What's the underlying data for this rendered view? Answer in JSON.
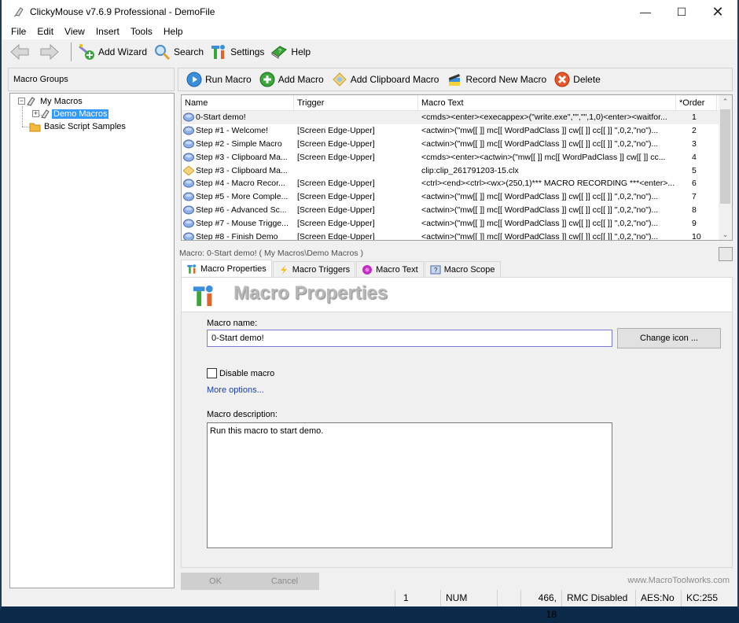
{
  "window": {
    "title": "ClickyMouse v7.6.9 Professional - DemoFile",
    "controls": [
      "minimize",
      "maximize",
      "close"
    ]
  },
  "menu": [
    "File",
    "Edit",
    "View",
    "Insert",
    "Tools",
    "Help"
  ],
  "toolbar": {
    "back_icon": "back-arrow-icon",
    "forward_icon": "forward-arrow-icon",
    "add_wizard": "Add Wizard",
    "search": "Search",
    "settings": "Settings",
    "help": "Help"
  },
  "groups": {
    "header": "Macro Groups",
    "tree": [
      {
        "label": "My Macros",
        "level": 0,
        "expanded": true
      },
      {
        "label": "Demo Macros",
        "level": 1,
        "selected": true
      },
      {
        "label": "Basic Script Samples",
        "level": 0
      }
    ]
  },
  "macro_toolbar": {
    "run": "Run Macro",
    "add": "Add Macro",
    "add_clipboard": "Add Clipboard Macro",
    "record": "Record New Macro",
    "delete": "Delete"
  },
  "macro_list": {
    "columns": [
      "Name",
      "Trigger",
      "Macro Text",
      "*Order"
    ],
    "rows": [
      {
        "name": "0-Start demo!",
        "trigger": "",
        "text": "<cmds><enter><execappex>(\"write.exe\",\"\",\"\",1,0)<enter><waitfor...",
        "order": "1",
        "icon": "macro"
      },
      {
        "name": "Step #1 - Welcome!",
        "trigger": "[Screen Edge-Upper]",
        "text": "<actwin>(\"mw[[ ]] mc[[ WordPadClass ]] cw[[ ]] cc[[ ]] \",0,2,\"no\")...",
        "order": "2",
        "icon": "macro"
      },
      {
        "name": "Step #2 - Simple Macro",
        "trigger": "[Screen Edge-Upper]",
        "text": "<actwin>(\"mw[[ ]] mc[[ WordPadClass ]] cw[[ ]] cc[[ ]] \",0,2,\"no\")...",
        "order": "3",
        "icon": "macro"
      },
      {
        "name": "Step #3 - Clipboard Ma...",
        "trigger": "[Screen Edge-Upper]",
        "text": "<cmds><enter><actwin>(\"mw[[ ]] mc[[ WordPadClass ]] cw[[ ]] cc...",
        "order": "4",
        "icon": "macro"
      },
      {
        "name": "Step #3 - Clipboard Ma...",
        "trigger": "",
        "text": "clip:clip_261791203-15.clx",
        "order": "5",
        "icon": "clipboard"
      },
      {
        "name": "Step #4 - Macro Recor...",
        "trigger": "[Screen Edge-Upper]",
        "text": "<ctrl><end><ctrl><wx>(250,1)*** MACRO RECORDING ***<enter>...",
        "order": "6",
        "icon": "macro"
      },
      {
        "name": "Step #5 - More Comple...",
        "trigger": "[Screen Edge-Upper]",
        "text": "<actwin>(\"mw[[ ]] mc[[ WordPadClass ]] cw[[ ]] cc[[ ]] \",0,2,\"no\")...",
        "order": "7",
        "icon": "macro"
      },
      {
        "name": "Step #6 - Advanced Sc...",
        "trigger": "[Screen Edge-Upper]",
        "text": "<actwin>(\"mw[[ ]] mc[[ WordPadClass ]] cw[[ ]] cc[[ ]] \",0,2,\"no\")...",
        "order": "8",
        "icon": "macro"
      },
      {
        "name": "Step #7 - Mouse Trigge...",
        "trigger": "[Screen Edge-Upper]",
        "text": "<actwin>(\"mw[[ ]] mc[[ WordPadClass ]] cw[[ ]] cc[[ ]] \",0,2,\"no\")...",
        "order": "9",
        "icon": "macro"
      },
      {
        "name": "Step #8 - Finish Demo",
        "trigger": "[Screen Edge-Upper]",
        "text": "<actwin>(\"mw[[ ]] mc[[ WordPadClass ]] cw[[ ]] cc[[ ]] \",0,2,\"no\")...",
        "order": "10",
        "icon": "macro"
      }
    ]
  },
  "detail": {
    "path": "Macro: 0-Start demo! ( My Macros\\Demo Macros )",
    "tabs": [
      "Macro Properties",
      "Macro Triggers",
      "Macro Text",
      "Macro Scope"
    ],
    "active_tab": "Macro Properties",
    "banner_title": "Macro Properties",
    "name_label": "Macro name:",
    "name_value": "0-Start demo!",
    "change_icon": "Change icon ...",
    "disable_label": "Disable macro",
    "disable_checked": false,
    "more_options": "More options...",
    "desc_label": "Macro description:",
    "desc_value": "Run this macro to start demo.",
    "ok": "OK",
    "cancel": "Cancel",
    "website": "www.MacroToolworks.com"
  },
  "status": {
    "count": "1",
    "num": "NUM",
    "coords": "466,  18",
    "rmc": "RMC Disabled",
    "aes": "AES:No",
    "kc": "KC:255"
  }
}
